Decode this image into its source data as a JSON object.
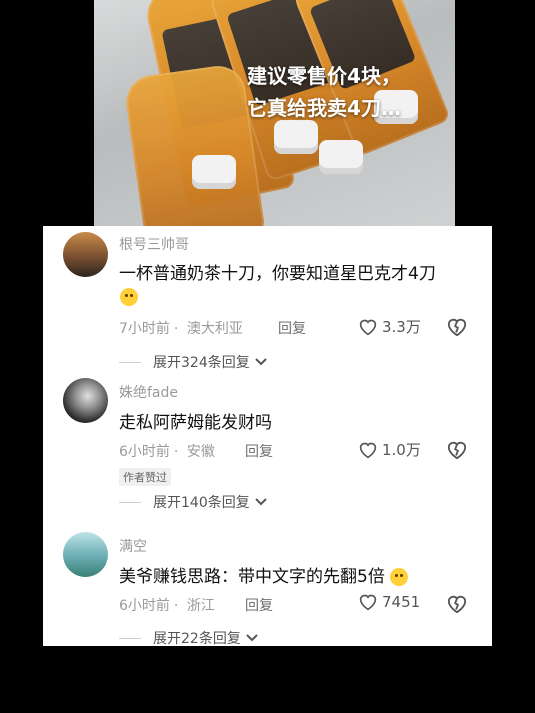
{
  "video": {
    "caption_line1": "建议零售价4块，",
    "caption_line2": "它真给我卖4刀…"
  },
  "comments": [
    {
      "username": "根号三帅哥",
      "text": "一杯普通奶茶十刀，你要知道星巴克才4刀",
      "emoji": "pleading-face",
      "time": "7小时前",
      "location": "澳大利亚",
      "reply_label": "回复",
      "likes": "3.3万",
      "expand_label": "展开324条回复"
    },
    {
      "username": "姝绝fade",
      "text": "走私阿萨姆能发财吗",
      "time": "6小时前",
      "location": "安徽",
      "reply_label": "回复",
      "likes": "1.0万",
      "author_tag": "作者赞过",
      "expand_label": "展开140条回复"
    },
    {
      "username": "满空",
      "text": "美爷赚钱思路：带中文字的先翻5倍",
      "emoji": "pleading-face",
      "time": "6小时前",
      "location": "浙江",
      "reply_label": "回复",
      "likes": "7451",
      "expand_label": "展开22条回复"
    }
  ],
  "colors": {
    "accent_text": "#111111",
    "muted_text": "#9a9a9a",
    "emoji": "#ffd03a",
    "bottle_orange": "#d7882a"
  }
}
